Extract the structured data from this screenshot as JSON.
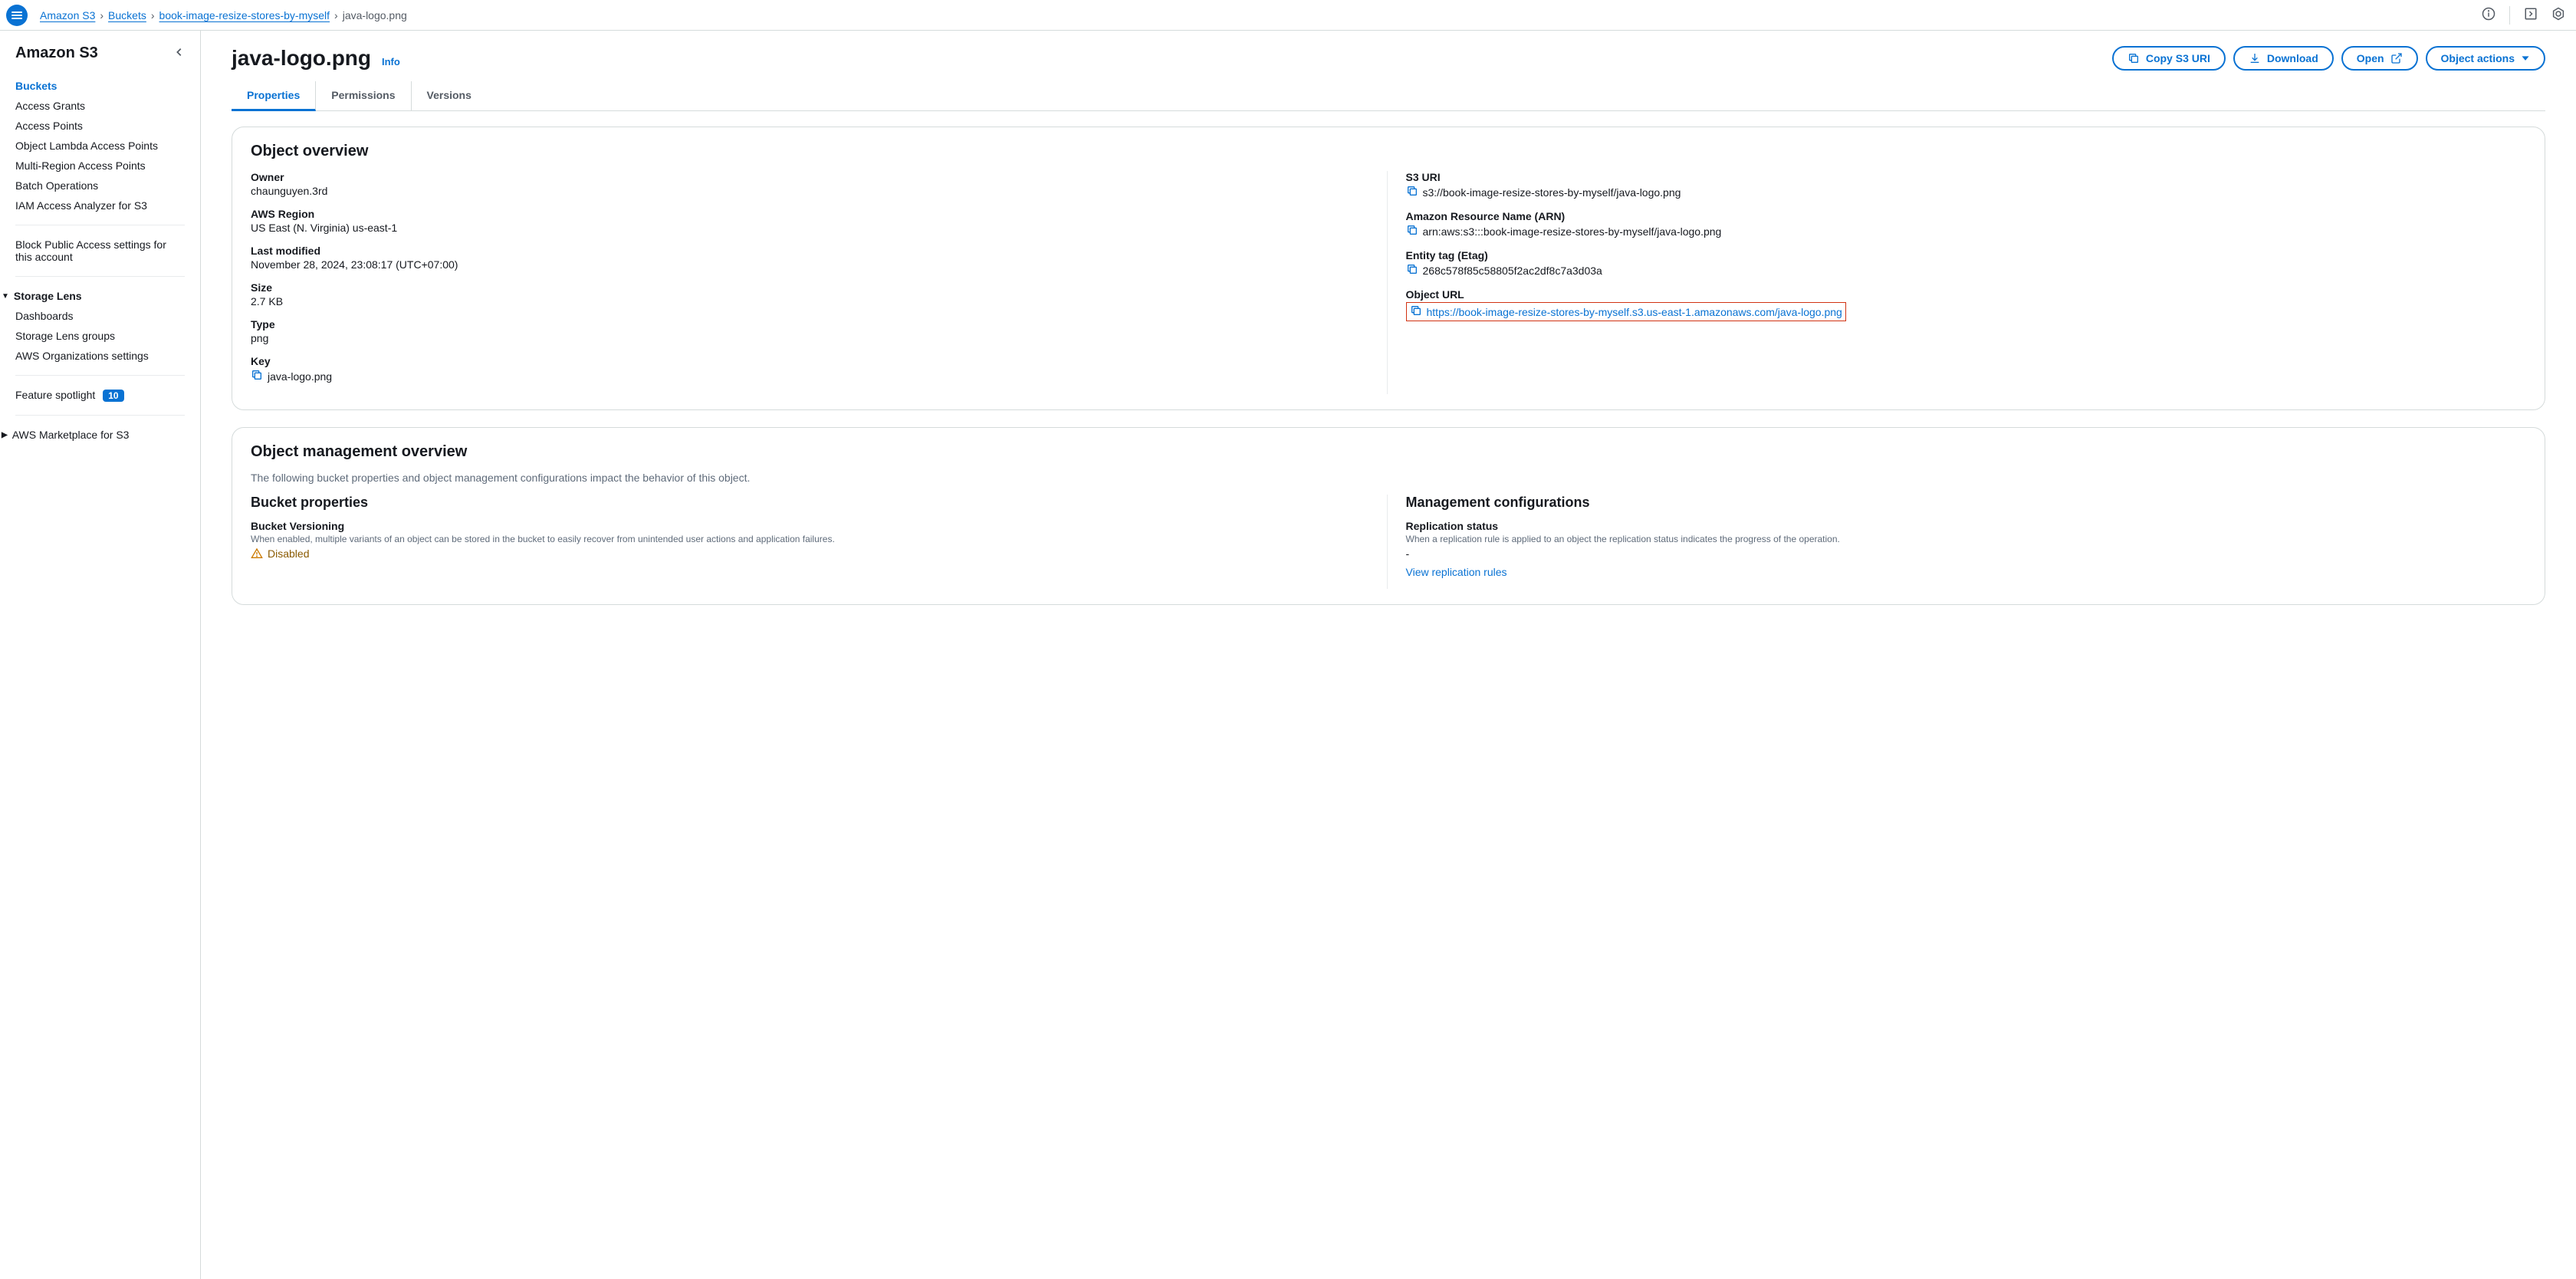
{
  "breadcrumb": {
    "service": "Amazon S3",
    "level1": "Buckets",
    "level2": "book-image-resize-stores-by-myself",
    "current": "java-logo.png"
  },
  "sidebar": {
    "title": "Amazon S3",
    "items": [
      "Buckets",
      "Access Grants",
      "Access Points",
      "Object Lambda Access Points",
      "Multi-Region Access Points",
      "Batch Operations",
      "IAM Access Analyzer for S3"
    ],
    "block_public": "Block Public Access settings for this account",
    "storage_lens_header": "Storage Lens",
    "storage_lens_items": [
      "Dashboards",
      "Storage Lens groups",
      "AWS Organizations settings"
    ],
    "feature_spotlight": "Feature spotlight",
    "feature_spotlight_badge": "10",
    "marketplace": "AWS Marketplace for S3"
  },
  "page": {
    "title": "java-logo.png",
    "info": "Info"
  },
  "buttons": {
    "copy_uri": "Copy S3 URI",
    "download": "Download",
    "open": "Open",
    "object_actions": "Object actions"
  },
  "tabs": [
    "Properties",
    "Permissions",
    "Versions"
  ],
  "overview": {
    "heading": "Object overview",
    "owner_label": "Owner",
    "owner_value": "chaunguyen.3rd",
    "region_label": "AWS Region",
    "region_value": "US East (N. Virginia) us-east-1",
    "last_modified_label": "Last modified",
    "last_modified_value": "November 28, 2024, 23:08:17 (UTC+07:00)",
    "size_label": "Size",
    "size_value": "2.7 KB",
    "type_label": "Type",
    "type_value": "png",
    "key_label": "Key",
    "key_value": "java-logo.png",
    "s3uri_label": "S3 URI",
    "s3uri_value": "s3://book-image-resize-stores-by-myself/java-logo.png",
    "arn_label": "Amazon Resource Name (ARN)",
    "arn_value": "arn:aws:s3:::book-image-resize-stores-by-myself/java-logo.png",
    "etag_label": "Entity tag (Etag)",
    "etag_value": "268c578f85c58805f2ac2df8c7a3d03a",
    "url_label": "Object URL",
    "url_value": "https://book-image-resize-stores-by-myself.s3.us-east-1.amazonaws.com/java-logo.png"
  },
  "mgmt": {
    "heading": "Object management overview",
    "desc": "The following bucket properties and object management configurations impact the behavior of this object.",
    "bucket_props_heading": "Bucket properties",
    "versioning_label": "Bucket Versioning",
    "versioning_desc": "When enabled, multiple variants of an object can be stored in the bucket to easily recover from unintended user actions and application failures.",
    "versioning_status": "Disabled",
    "mgmt_configs_heading": "Management configurations",
    "replication_label": "Replication status",
    "replication_desc": "When a replication rule is applied to an object the replication status indicates the progress of the operation.",
    "replication_value": "-",
    "view_replication_link": "View replication rules"
  }
}
